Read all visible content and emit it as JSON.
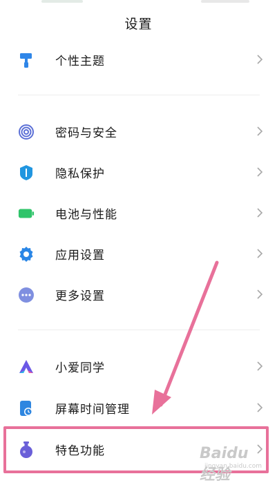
{
  "header": {
    "title": "设置"
  },
  "settings": [
    {
      "name": "personal-theme",
      "label": "个性主题",
      "icon": "paint-roller-icon",
      "color": "#2f86e8"
    },
    {
      "name": "password-security",
      "label": "密码与安全",
      "icon": "fingerprint-icon",
      "color": "#5b6fd6"
    },
    {
      "name": "privacy",
      "label": "隐私保护",
      "icon": "shield-icon",
      "color": "#2196e0"
    },
    {
      "name": "battery",
      "label": "电池与性能",
      "icon": "battery-icon",
      "color": "#2fc46a"
    },
    {
      "name": "app-settings",
      "label": "应用设置",
      "icon": "gear-icon",
      "color": "#2a86e6"
    },
    {
      "name": "more-settings",
      "label": "更多设置",
      "icon": "more-dots-icon",
      "color": "#7f8fe0"
    },
    {
      "name": "xiaoai",
      "label": "小爱同学",
      "icon": "xiaoai-icon",
      "color": "#6b58e6"
    },
    {
      "name": "screen-time",
      "label": "屏幕时间管理",
      "icon": "screen-time-icon",
      "color": "#2e86e0"
    },
    {
      "name": "special-features",
      "label": "特色功能",
      "icon": "flask-icon",
      "color": "#6a5fd8"
    }
  ],
  "annotation": {
    "highlight_color": "#e8719a"
  },
  "watermark": {
    "text": "Baidu经验",
    "sub": "jingyan.baidu.com"
  }
}
